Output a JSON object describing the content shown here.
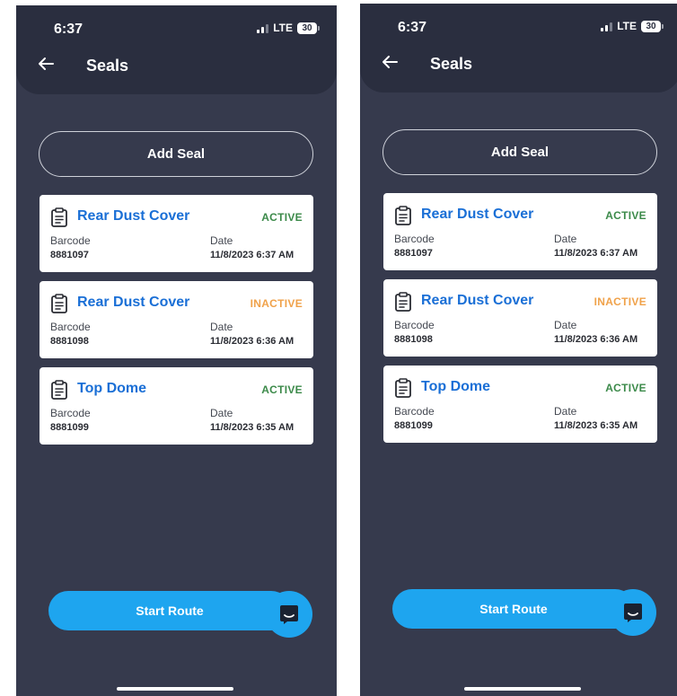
{
  "screens": [
    {
      "status_bar": {
        "time": "6:37",
        "network": "LTE",
        "battery": "30",
        "signal_icon": "signal-icon"
      },
      "header": {
        "title": "Seals",
        "back_icon": "arrow-left-icon"
      },
      "add_seal_label": "Add Seal",
      "seals": [
        {
          "name": "Rear Dust Cover",
          "status": "ACTIVE",
          "status_type": "active",
          "barcode_label": "Barcode",
          "barcode": "8881097",
          "date_label": "Date",
          "date": "11/8/2023 6:37 AM"
        },
        {
          "name": "Rear Dust Cover",
          "status": "INACTIVE",
          "status_type": "inactive",
          "barcode_label": "Barcode",
          "barcode": "8881098",
          "date_label": "Date",
          "date": "11/8/2023 6:36 AM"
        },
        {
          "name": "Top Dome",
          "status": "ACTIVE",
          "status_type": "active",
          "barcode_label": "Barcode",
          "barcode": "8881099",
          "date_label": "Date",
          "date": "11/8/2023 6:35 AM"
        }
      ],
      "start_route_label": "Start Route",
      "chat_icon": "chat-icon"
    },
    {
      "status_bar": {
        "time": "6:37",
        "network": "LTE",
        "battery": "30",
        "signal_icon": "signal-icon"
      },
      "header": {
        "title": "Seals",
        "back_icon": "arrow-left-icon"
      },
      "add_seal_label": "Add Seal",
      "seals": [
        {
          "name": "Rear Dust Cover",
          "status": "ACTIVE",
          "status_type": "active",
          "barcode_label": "Barcode",
          "barcode": "8881097",
          "date_label": "Date",
          "date": "11/8/2023 6:37 AM"
        },
        {
          "name": "Rear Dust Cover",
          "status": "INACTIVE",
          "status_type": "inactive",
          "barcode_label": "Barcode",
          "barcode": "8881098",
          "date_label": "Date",
          "date": "11/8/2023 6:36 AM"
        },
        {
          "name": "Top Dome",
          "status": "ACTIVE",
          "status_type": "active",
          "barcode_label": "Barcode",
          "barcode": "8881099",
          "date_label": "Date",
          "date": "11/8/2023 6:35 AM"
        }
      ],
      "start_route_label": "Start Route",
      "chat_icon": "chat-icon"
    }
  ],
  "colors": {
    "background": "#363a4d",
    "header": "#2a2e3f",
    "accent": "#1ea5ef",
    "seal_name": "#1a6fd6",
    "active": "#3c8a4a",
    "inactive": "#f0a24a"
  }
}
